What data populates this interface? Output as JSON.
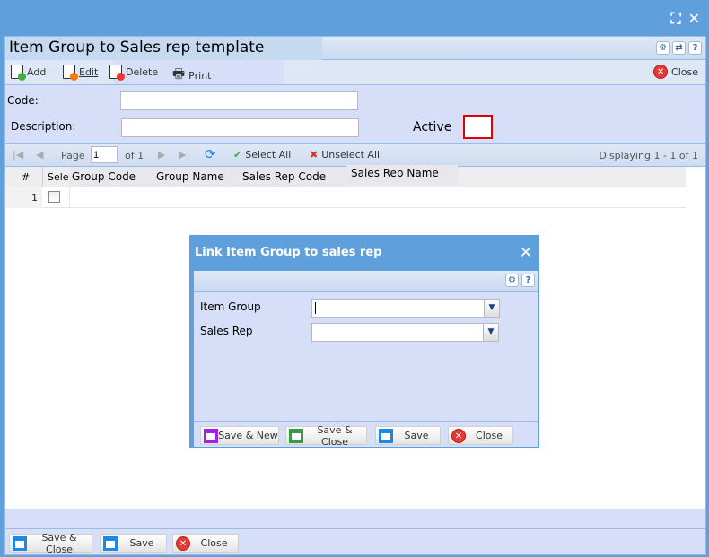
{
  "window": {
    "maximize_icon": "expand-icon",
    "close_icon": "close-icon"
  },
  "panel": {
    "title": "Item Group to Sales rep template",
    "tools": [
      "gear-icon",
      "refresh-icon",
      "help-icon"
    ]
  },
  "toolbar": {
    "add": "Add",
    "edit": "Edit",
    "delete": "Delete",
    "print": "Print",
    "close": "Close"
  },
  "form": {
    "code_label": "Code:",
    "code_value": "",
    "description_label": "Description:",
    "description_value": "",
    "active_label": "Active"
  },
  "pager": {
    "page_label": "Page",
    "page_value": "1",
    "of_label": "of 1",
    "select_all": "Select All",
    "unselect_all": "Unselect All",
    "displaying": "Displaying 1 - 1 of 1"
  },
  "grid": {
    "columns": [
      "#",
      "Selec",
      "Group Code",
      "Group Name",
      "Sales Rep Code",
      "Sales Rep Name"
    ],
    "rows": [
      {
        "num": "1",
        "selected": false
      }
    ]
  },
  "footer": {
    "save_close": "Save & Close",
    "save": "Save",
    "close": "Close"
  },
  "dialog": {
    "title": "Link Item Group to sales rep",
    "item_group_label": "Item Group",
    "item_group_value": "",
    "sales_rep_label": "Sales Rep",
    "sales_rep_value": "",
    "save_new": "Save & New",
    "save_close": "Save & Close",
    "save": "Save",
    "close": "Close"
  },
  "colors": {
    "frame": "#5fa0dc",
    "panel": "#d6dff7",
    "active_border": "#e00000"
  }
}
